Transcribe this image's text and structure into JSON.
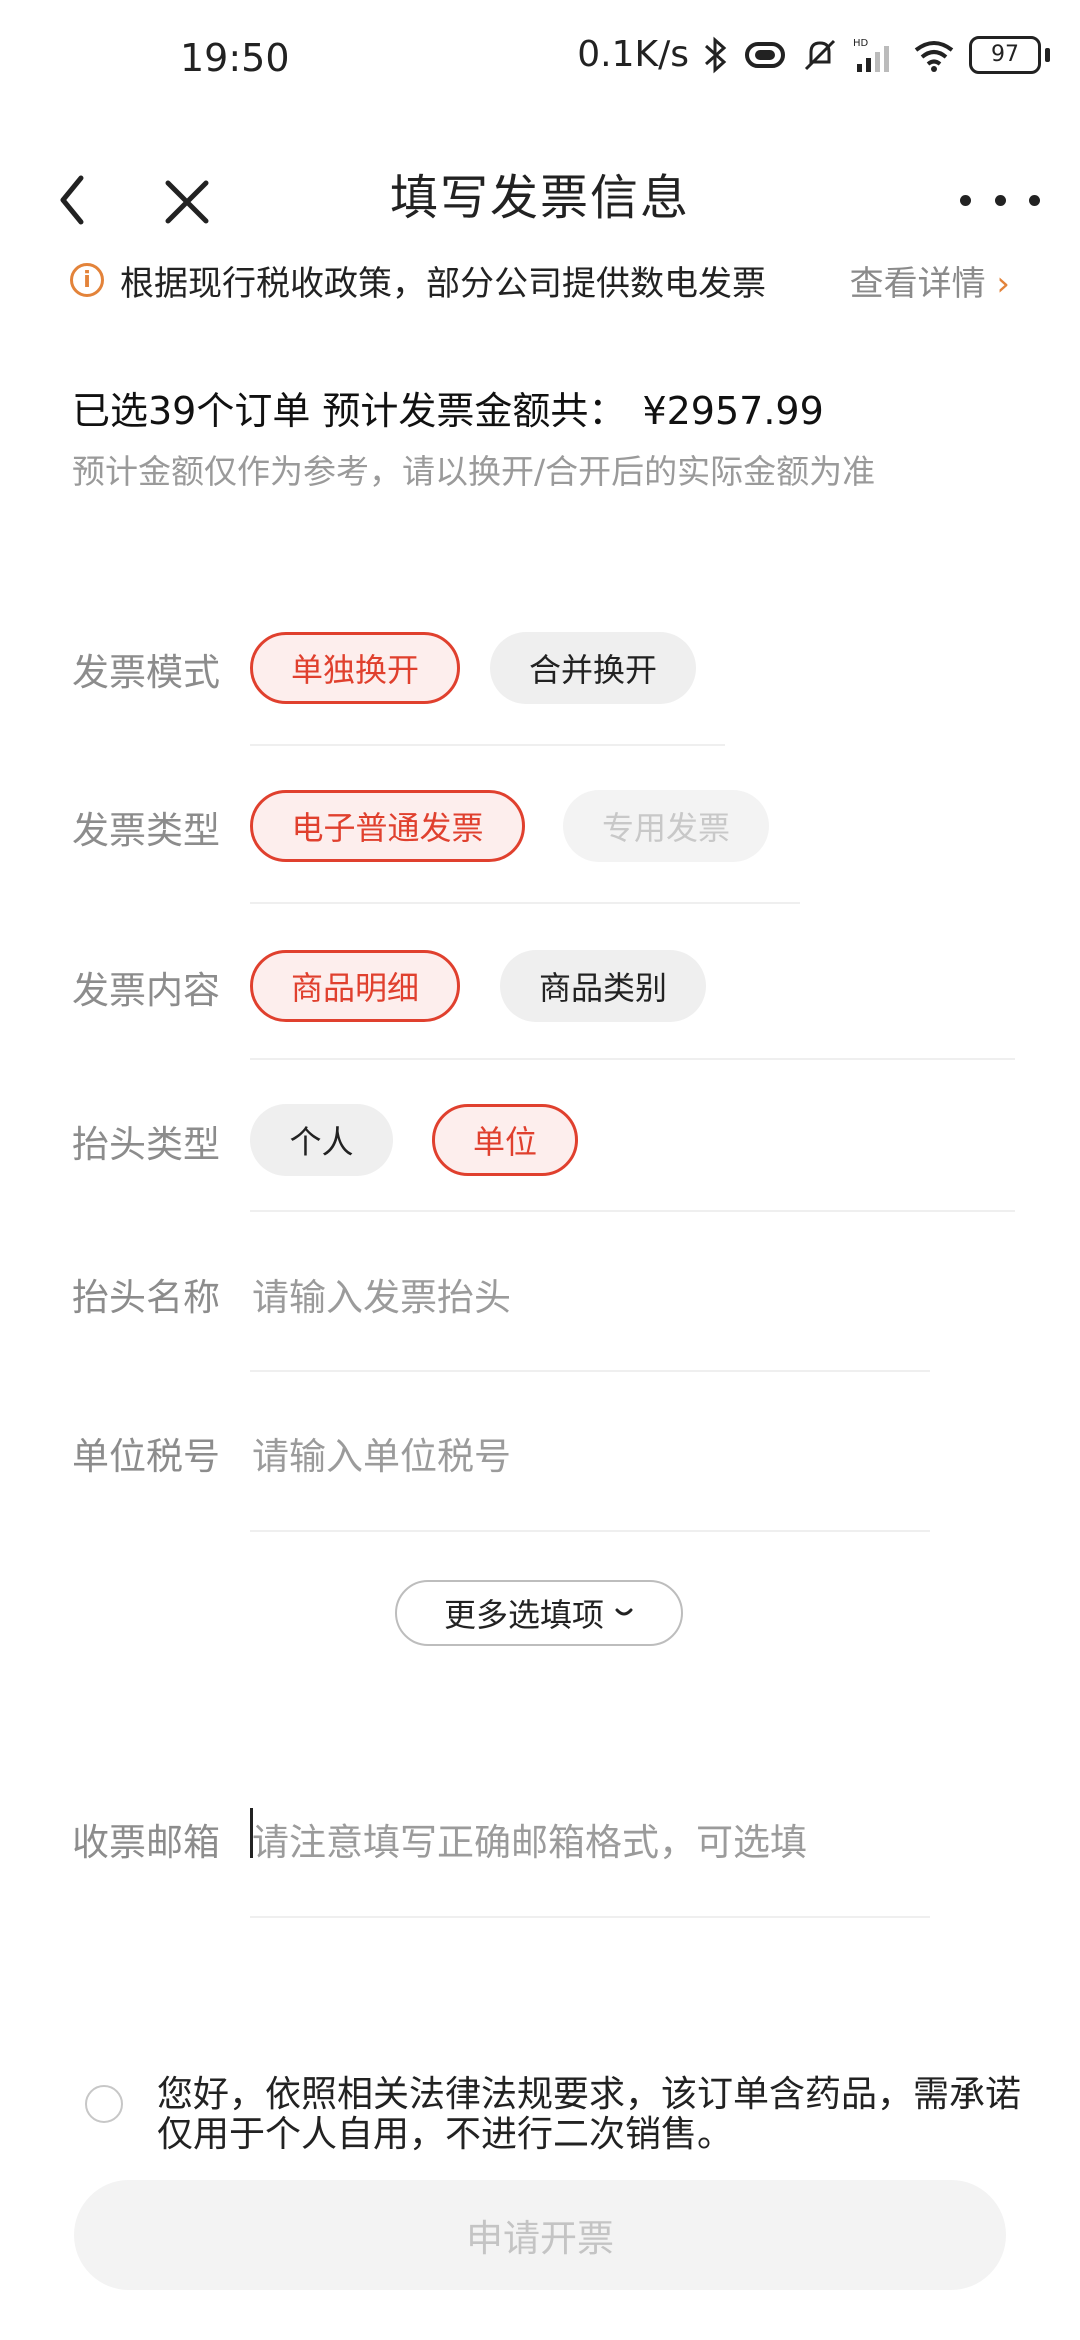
{
  "status_bar": {
    "time": "19:50",
    "speed": "0.1K/s",
    "battery": "97"
  },
  "nav": {
    "title": "填写发票信息"
  },
  "notice": {
    "text": "根据现行税收政策，部分公司提供数电发票",
    "link": "查看详情",
    "link_arrow": "›",
    "info_glyph": "i"
  },
  "summary": {
    "selected": "已选39个订单 预计发票金额共：",
    "amount": "¥2957.99",
    "note": "预计金额仅作为参考，请以换开/合开后的实际金额为准"
  },
  "form": {
    "mode": {
      "label": "发票模式",
      "options": [
        "单独换开",
        "合并换开"
      ],
      "selected": "单独换开"
    },
    "type": {
      "label": "发票类型",
      "options": [
        "电子普通发票",
        "专用发票"
      ],
      "selected": "电子普通发票",
      "disabled": [
        "专用发票"
      ]
    },
    "content": {
      "label": "发票内容",
      "options": [
        "商品明细",
        "商品类别"
      ],
      "selected": "商品明细"
    },
    "title_type": {
      "label": "抬头类型",
      "options": [
        "个人",
        "单位"
      ],
      "selected": "单位"
    },
    "title_name": {
      "label": "抬头名称",
      "placeholder": "请输入发票抬头"
    },
    "tax_id": {
      "label": "单位税号",
      "placeholder": "请输入单位税号"
    },
    "more_options": "更多选填项",
    "email": {
      "label": "收票邮箱",
      "placeholder": "请注意填写正确邮箱格式，可选填"
    }
  },
  "agreement": {
    "text": "您好，依照相关法律法规要求，该订单含药品，需承诺仅用于个人自用，不进行二次销售。",
    "checked": false
  },
  "submit": {
    "label": "申请开票"
  },
  "colors": {
    "accent": "#e0402e",
    "notice_icon": "#e3833a"
  }
}
